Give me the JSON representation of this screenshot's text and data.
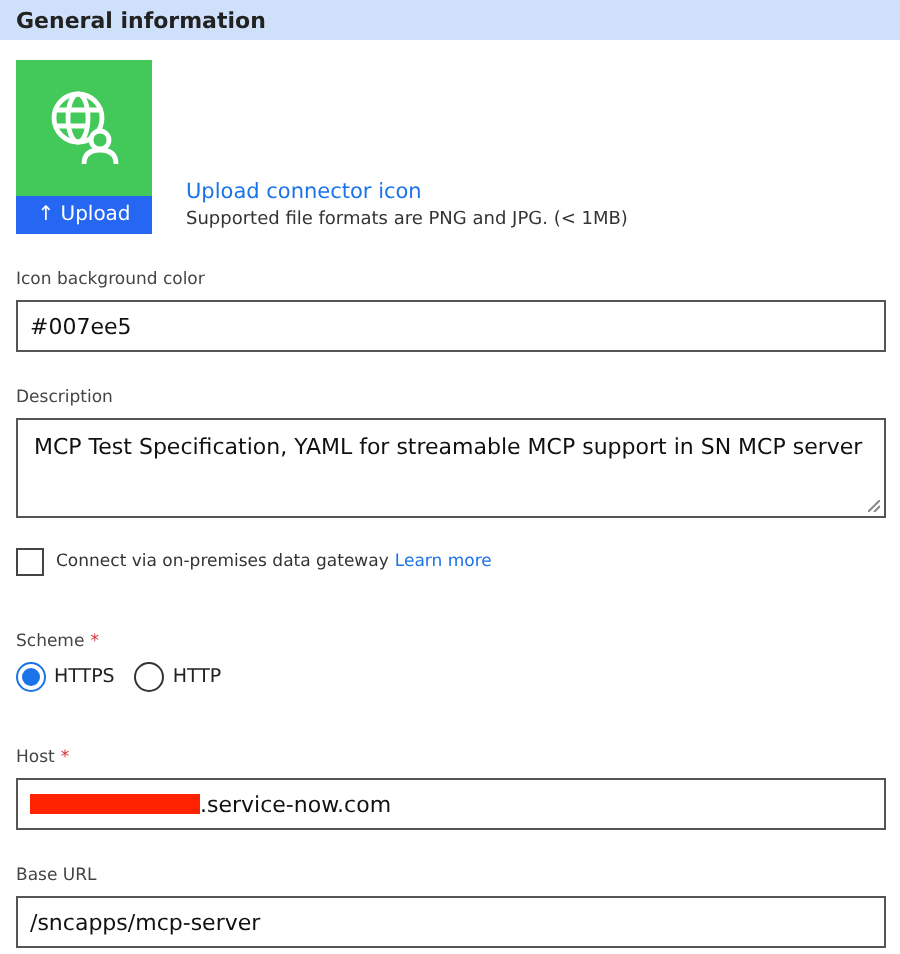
{
  "section": {
    "title": "General information"
  },
  "icon_upload": {
    "button": "↑ Upload",
    "link": "Upload connector icon",
    "hint": "Supported file formats are PNG and JPG. (< 1MB)"
  },
  "icon_background": {
    "label": "Icon background color",
    "value": "#007ee5"
  },
  "description": {
    "label": "Description",
    "value": "MCP Test Specification, YAML for streamable MCP support in SN MCP server"
  },
  "gateway": {
    "label": "Connect via on-premises data gateway",
    "link": "Learn more",
    "checked": false
  },
  "scheme": {
    "label": "Scheme",
    "required_mark": "*",
    "options": [
      {
        "label": "HTTPS",
        "selected": true
      },
      {
        "label": "HTTP",
        "selected": false
      }
    ]
  },
  "host": {
    "label": "Host",
    "required_mark": "*",
    "value": ".service-now.com",
    "redacted": true
  },
  "base_url": {
    "label": "Base URL",
    "value": "/sncapps/mcp-server"
  }
}
